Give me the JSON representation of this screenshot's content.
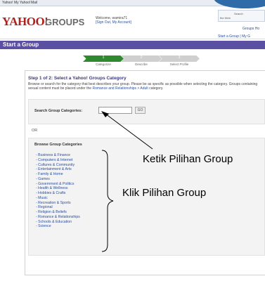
{
  "topnav": {
    "links": [
      "Yahoo!",
      "My Yahoo!",
      "Mail"
    ]
  },
  "header": {
    "logo_text": "YAHOO!",
    "logo_groups": "GROUPS",
    "welcome_line": "Welcome, wamira71",
    "welcome_links": "[Sign Out, My Account]",
    "search_label": "Search",
    "search_scope": "the Web",
    "groups_link": "Groups Ho",
    "start_link": "Start a Group | My G"
  },
  "title_bar": "Start a Group",
  "steps": [
    {
      "number": "1",
      "label": "Categorize"
    },
    {
      "number": "2",
      "label": "Describe"
    },
    {
      "number": "3",
      "label": "Select Profile"
    }
  ],
  "main": {
    "step_heading": "Step 1 of 2: Select a Yahoo! Groups Category",
    "instructions_pre": "Browse or search for the category that best describes your group. Please be as specific as possible when selecting the category. Groups containing sexual content must be placed under the ",
    "instructions_link": "Romance and Relationships > Adult",
    "instructions_post": " category.",
    "search_label": "Search Group Categories:",
    "go_label": "GO",
    "or_label": "OR",
    "browse_heading": "Browse Group Categories",
    "categories": [
      "Business & Finance",
      "Computers & Internet",
      "Cultures & Community",
      "Entertainment & Arts",
      "Family & Home",
      "Games",
      "Government & Politics",
      "Health & Wellness",
      "Hobbies & Crafts",
      "Music",
      "Recreation & Sports",
      "Regional",
      "Religion & Beliefs",
      "Romance & Relationships",
      "Schools & Education",
      "Science"
    ]
  },
  "annotations": {
    "type_note": "Ketik Pilihan Group",
    "click_note": "Klik Pilihan Group"
  },
  "colors": {
    "title_bar": "#5a4fa0",
    "step_active": "#2f8a2f",
    "step_inactive": "#cccccc",
    "link": "#2a4fa0",
    "logo": "#b0201c"
  }
}
